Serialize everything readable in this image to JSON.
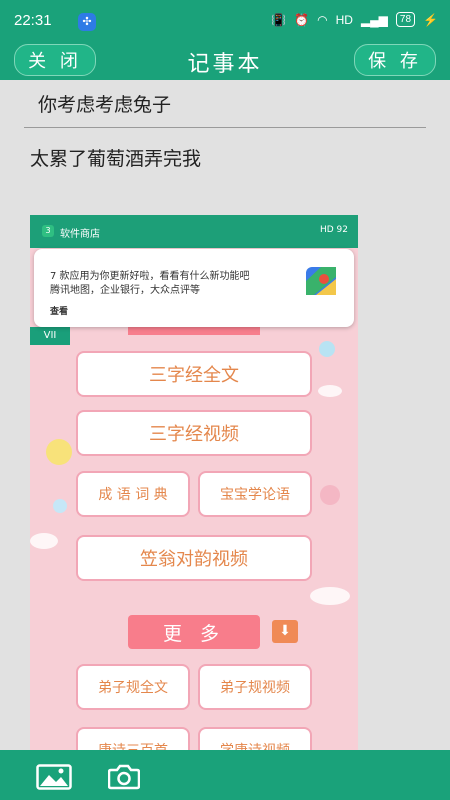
{
  "status": {
    "time": "22:31",
    "network": "HD",
    "battery": "78"
  },
  "header": {
    "close_label": "关 闭",
    "title": "记事本",
    "save_label": "保 存"
  },
  "note": {
    "title": "你考虑考虑兔子",
    "body": "太累了葡萄酒弄完我"
  },
  "embedded": {
    "status_label": "软件商店",
    "status_right": "HD 92",
    "notification": {
      "line1": "7 款应用为你更新好啦，看看有什么新功能吧",
      "line2": "腾讯地图，企业银行，大众点评等",
      "action": "查看"
    },
    "buttons": {
      "b1": "三字经全文",
      "b2": "三字经视频",
      "b3": "成 语 词 典",
      "b4": "宝宝学论语",
      "b5": "笠翁对韵视频",
      "more": "更 多",
      "b6": "弟子规全文",
      "b7": "弟子规视频",
      "b8": "唐诗三百首",
      "b9": "学唐诗视频"
    }
  },
  "bottom": {
    "icons": [
      "image-icon",
      "camera-icon"
    ]
  },
  "colors": {
    "primary": "#1aa27a",
    "pink": "#f7cfd6",
    "orange_text": "#e4874c"
  }
}
